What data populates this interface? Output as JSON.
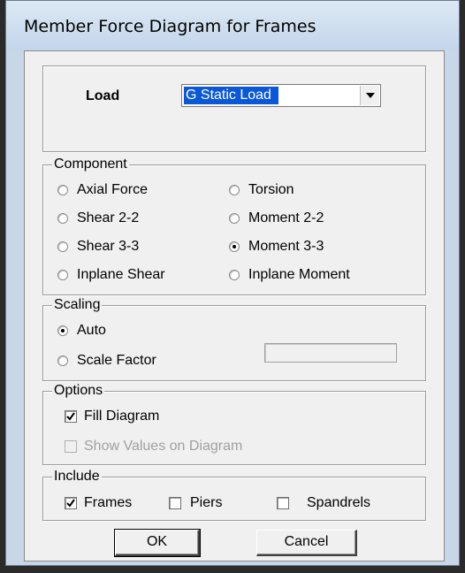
{
  "window": {
    "title": "Member Force Diagram for Frames"
  },
  "load": {
    "label": "Load",
    "selected": "G Static Load"
  },
  "component": {
    "legend": "Component",
    "options": [
      "Axial Force",
      "Torsion",
      "Shear 2-2",
      "Moment 2-2",
      "Shear 3-3",
      "Moment 3-3",
      "Inplane Shear",
      "Inplane Moment"
    ],
    "selected": "Moment 3-3"
  },
  "scaling": {
    "legend": "Scaling",
    "auto_label": "Auto",
    "scale_factor_label": "Scale Factor",
    "selected": "Auto",
    "scale_factor_value": ""
  },
  "options": {
    "legend": "Options",
    "fill_diagram_label": "Fill Diagram",
    "fill_diagram_checked": true,
    "show_values_label": "Show Values on Diagram",
    "show_values_checked": false
  },
  "include": {
    "legend": "Include",
    "frames_label": "Frames",
    "frames_checked": true,
    "piers_label": "Piers",
    "piers_checked": false,
    "spandrels_label": "Spandrels",
    "spandrels_checked": false
  },
  "buttons": {
    "ok_label": "OK",
    "cancel_label": "Cancel"
  }
}
